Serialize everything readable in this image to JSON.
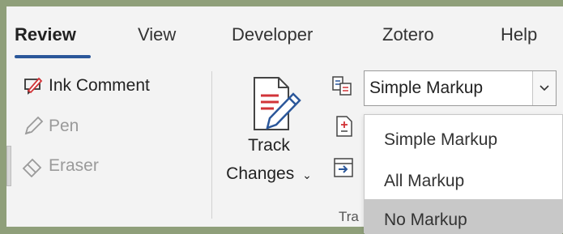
{
  "tabs": [
    {
      "label": "Review",
      "active": true
    },
    {
      "label": "View",
      "active": false
    },
    {
      "label": "Developer",
      "active": false
    },
    {
      "label": "Zotero",
      "active": false
    },
    {
      "label": "Help",
      "active": false
    }
  ],
  "proofing": {
    "ink_comment": "Ink Comment",
    "pen": "Pen",
    "eraser": "Eraser"
  },
  "tracking": {
    "track_changes_line1": "Track",
    "track_changes_line2": "Changes",
    "group_label_partial": "Tra",
    "markup_selected": "Simple Markup",
    "markup_options": [
      "Simple Markup",
      "All Markup",
      "No Markup"
    ],
    "hovered_option": "No Markup"
  },
  "colors": {
    "accent": "#2b579a",
    "ink_red": "#d13438",
    "hover": "#c8c8c8"
  }
}
